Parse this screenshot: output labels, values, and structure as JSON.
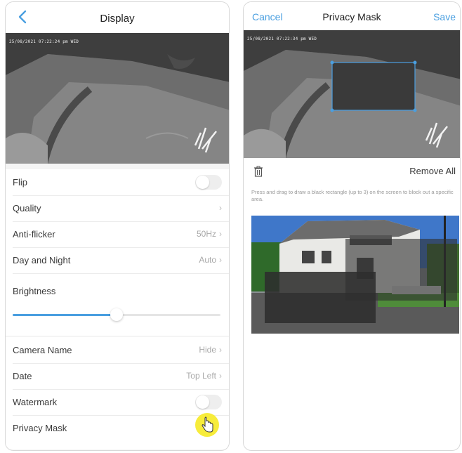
{
  "left_screen": {
    "title": "Display",
    "camera_timestamp": "25/08/2021 07:22:24 pm WED",
    "rows": [
      {
        "label": "Flip",
        "value": "",
        "control": "toggle",
        "on": false
      },
      {
        "label": "Quality",
        "value": "",
        "control": "chevron"
      },
      {
        "label": "Anti-flicker",
        "value": "50Hz",
        "control": "chevron"
      },
      {
        "label": "Day and Night",
        "value": "Auto",
        "control": "chevron"
      }
    ],
    "brightness": {
      "label": "Brightness",
      "level": 0.5
    },
    "rows2": [
      {
        "label": "Camera Name",
        "value": "Hide",
        "control": "chevron"
      },
      {
        "label": "Date",
        "value": "Top Left",
        "control": "chevron"
      },
      {
        "label": "Watermark",
        "value": "",
        "control": "toggle",
        "on": false
      },
      {
        "label": "Privacy Mask",
        "value": "",
        "control": "none"
      }
    ]
  },
  "right_screen": {
    "cancel_label": "Cancel",
    "title": "Privacy Mask",
    "save_label": "Save",
    "camera_timestamp": "25/08/2021 07:22:34 pm WED",
    "remove_all_label": "Remove All",
    "hint": "Press and drag to draw a black rectangle (up to 3) on the screen to block out a specific area."
  },
  "colors": {
    "accent": "#4a9fe0",
    "cursor_highlight": "#f7ec3b"
  },
  "icons": [
    "back-chevron-icon",
    "chevron-right-icon",
    "trash-icon",
    "hand-pointer-icon"
  ]
}
